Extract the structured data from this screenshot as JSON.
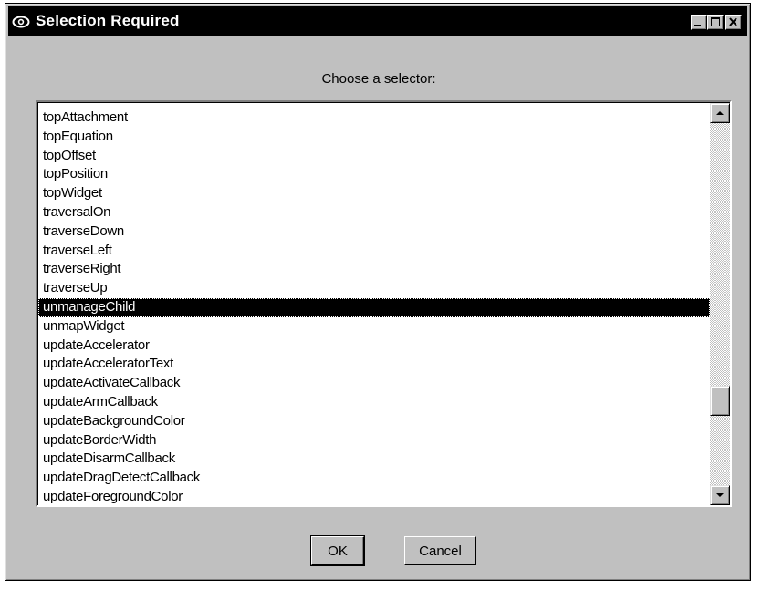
{
  "window": {
    "title": "Selection Required",
    "icon": "eye-icon",
    "controls": [
      "minimize-icon",
      "maximize-icon",
      "close-icon"
    ]
  },
  "prompt": "Choose a selector:",
  "list": {
    "items": [
      "topAttachment",
      "topEquation",
      "topOffset",
      "topPosition",
      "topWidget",
      "traversalOn",
      "traverseDown",
      "traverseLeft",
      "traverseRight",
      "traverseUp",
      "unmanageChild",
      "unmapWidget",
      "updateAccelerator",
      "updateAcceleratorText",
      "updateActivateCallback",
      "updateArmCallback",
      "updateBackgroundColor",
      "updateBorderWidth",
      "updateDisarmCallback",
      "updateDragDetectCallback",
      "updateForegroundColor"
    ],
    "selected_index": 10,
    "selected_value": "unmanageChild"
  },
  "buttons": {
    "ok": "OK",
    "cancel": "Cancel"
  },
  "colors": {
    "face": "#c0c0c0",
    "titlebar": "#000000",
    "selection": "#000000"
  }
}
